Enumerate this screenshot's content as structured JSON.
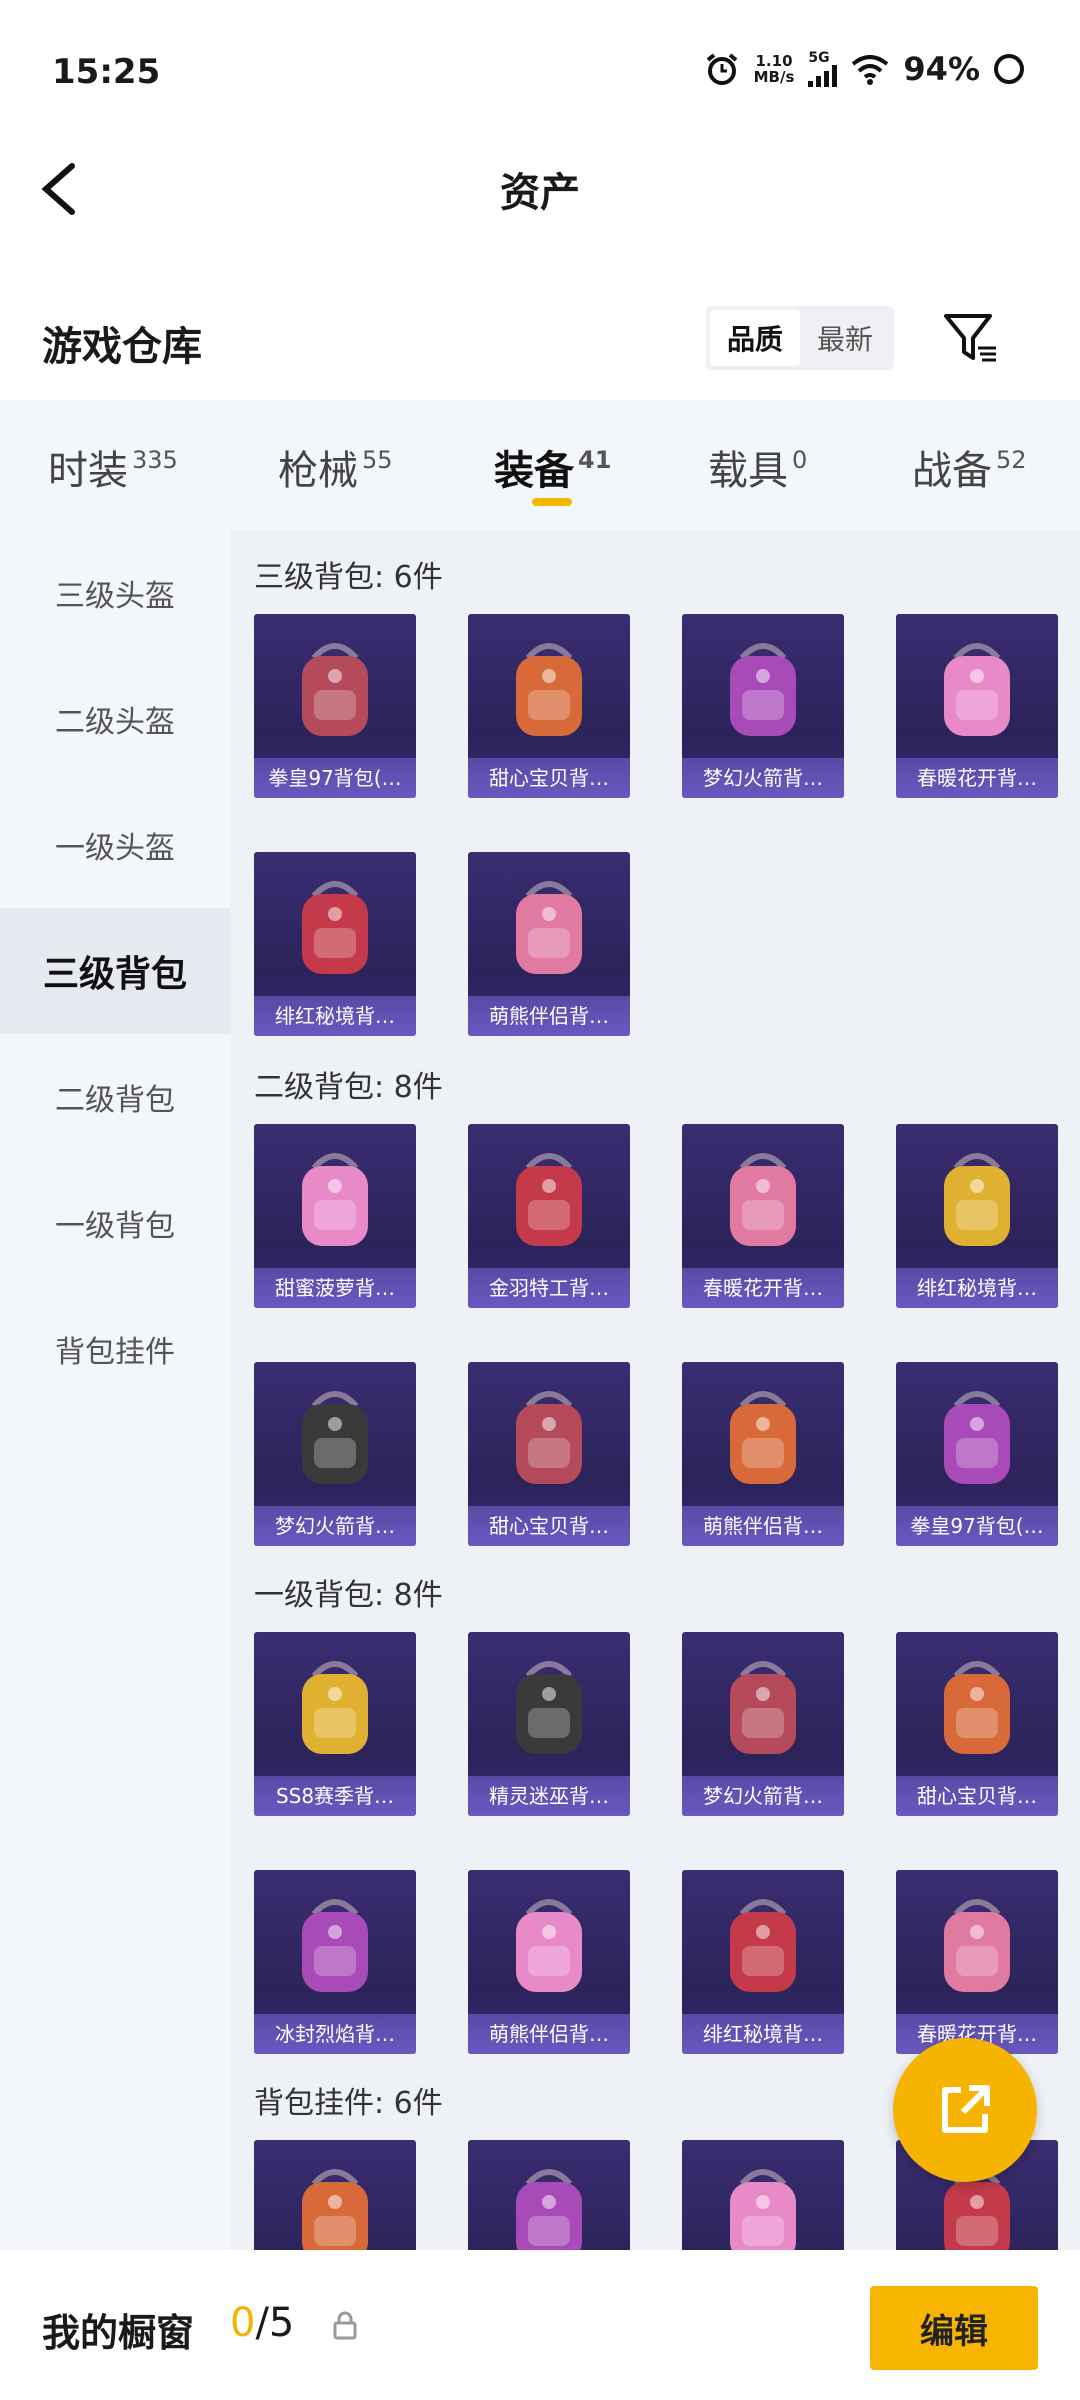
{
  "status": {
    "time": "15:25",
    "speed_top": "1.10",
    "speed_bottom": "MB/s",
    "network": "5G",
    "battery": "94%"
  },
  "header": {
    "title": "资产"
  },
  "warehouse": {
    "title": "游戏仓库",
    "sort_options": [
      "品质",
      "最新"
    ],
    "sort_selected": "品质"
  },
  "category_tabs": [
    {
      "label": "时装",
      "count": "335"
    },
    {
      "label": "枪械",
      "count": "55"
    },
    {
      "label": "装备",
      "count": "41",
      "active": true
    },
    {
      "label": "载具",
      "count": "0"
    },
    {
      "label": "战备",
      "count": "52"
    }
  ],
  "side_menu": [
    {
      "label": "三级头盔"
    },
    {
      "label": "二级头盔"
    },
    {
      "label": "一级头盔"
    },
    {
      "label": "三级背包",
      "active": true
    },
    {
      "label": "二级背包"
    },
    {
      "label": "一级背包"
    },
    {
      "label": "背包挂件"
    }
  ],
  "sections": [
    {
      "title": "三级背包: 6件",
      "items": [
        "拳皇97背包(…",
        "甜心宝贝背…",
        "梦幻火箭背…",
        "春暖花开背…",
        "绯红秘境背…",
        "萌熊伴侣背…"
      ]
    },
    {
      "title": "二级背包: 8件",
      "items": [
        "甜蜜菠萝背…",
        "金羽特工背…",
        "春暖花开背…",
        "绯红秘境背…",
        "梦幻火箭背…",
        "甜心宝贝背…",
        "萌熊伴侣背…",
        "拳皇97背包(…"
      ]
    },
    {
      "title": "一级背包: 8件",
      "items": [
        "SS8赛季背…",
        "精灵迷巫背…",
        "梦幻火箭背…",
        "甜心宝贝背…",
        "冰封烈焰背…",
        "萌熊伴侣背…",
        "绯红秘境背…",
        "春暖花开背…"
      ]
    },
    {
      "title": "背包挂件: 6件",
      "items": [
        "",
        "",
        "",
        ""
      ]
    }
  ],
  "bottom": {
    "label": "我的橱窗",
    "used": "0",
    "total": "/5",
    "edit_label": "编辑"
  },
  "colors": {
    "accent": "#f6b400",
    "card_bg": "#2c235a",
    "card_label": "#6b58c0"
  },
  "icons": {
    "back": "chevron-left-icon",
    "filter": "filter-icon",
    "share": "external-link-icon",
    "lock": "lock-icon"
  }
}
